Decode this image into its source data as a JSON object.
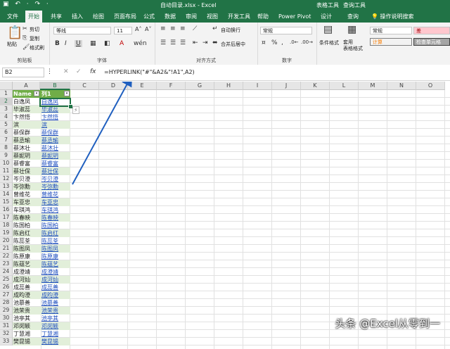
{
  "app": {
    "window_title": "自动目录.xlsx  -  Excel",
    "context_tabs": [
      "表格工具",
      "查询工具"
    ],
    "quick_access": "▣ ↶ · ↷ ·"
  },
  "tabs": [
    "文件",
    "开始",
    "共享",
    "插入",
    "绘图",
    "页面布局",
    "公式",
    "数据",
    "审阅",
    "视图",
    "开发工具",
    "帮助",
    "Power Pivot",
    "设计",
    "查询"
  ],
  "tell_me": "操作说明搜索",
  "ribbon": {
    "clipboard": {
      "paste": "粘贴",
      "cut": "剪切",
      "copy": "复制",
      "format_painter": "格式刷",
      "label": "剪贴板"
    },
    "font": {
      "name": "等线",
      "size": "11",
      "bold": "B",
      "italic": "I",
      "underline": "U",
      "label": "字体"
    },
    "alignment": {
      "wrap_text": "自动换行",
      "merge": "合并后居中",
      "label": "对齐方式"
    },
    "number": {
      "format": "常规",
      "label": "数字"
    },
    "styles": {
      "conditional": "条件格式",
      "table_format": "套用\n表格格式",
      "normal": "常规",
      "bad": "差",
      "calculation": "计算",
      "check_cell": "检查单元格"
    }
  },
  "formula_bar": {
    "name_box": "B2",
    "fx": "fx",
    "formula": "=HYPERLINK(\"#\"&A2&\"!A1\",A2)"
  },
  "sheet": {
    "columns": [
      "A",
      "B",
      "C",
      "D",
      "E",
      "F",
      "G",
      "H",
      "I",
      "J",
      "K",
      "L",
      "M",
      "N",
      "O"
    ],
    "header_a": "Name",
    "header_b": "列1",
    "row_numbers": [
      "1",
      "2",
      "3",
      "4",
      "5",
      "6",
      "7",
      "8",
      "9",
      "10",
      "11",
      "12",
      "13",
      "14",
      "15",
      "16",
      "17",
      "18",
      "19",
      "20",
      "21",
      "22",
      "23",
      "24",
      "25",
      "26",
      "27",
      "28",
      "29",
      "30",
      "31",
      "32",
      "33"
    ],
    "names": [
      "白逸凤",
      "毕淑蕊",
      "卞然悟",
      "滨",
      "蔡保群",
      "蔡丞瑜",
      "蔡沐壮",
      "蔡妮玥",
      "蔡睿富",
      "蔡壮保",
      "岑贝澄",
      "岑弥勳",
      "曾维花",
      "车亚忠",
      "车琪鸿",
      "陈春映",
      "陈国柏",
      "陈启红",
      "陈蕊荃",
      "陈图凤",
      "陈原康",
      "陈蕴艺",
      "成澄靖",
      "成河灿",
      "成蕊善",
      "成昀澄",
      "池慕善",
      "池荣贵",
      "池亭其",
      "邓闵颖",
      "丁慧湘",
      "樊昆锡"
    ]
  },
  "watermark": "头条 @Excel从零到一"
}
